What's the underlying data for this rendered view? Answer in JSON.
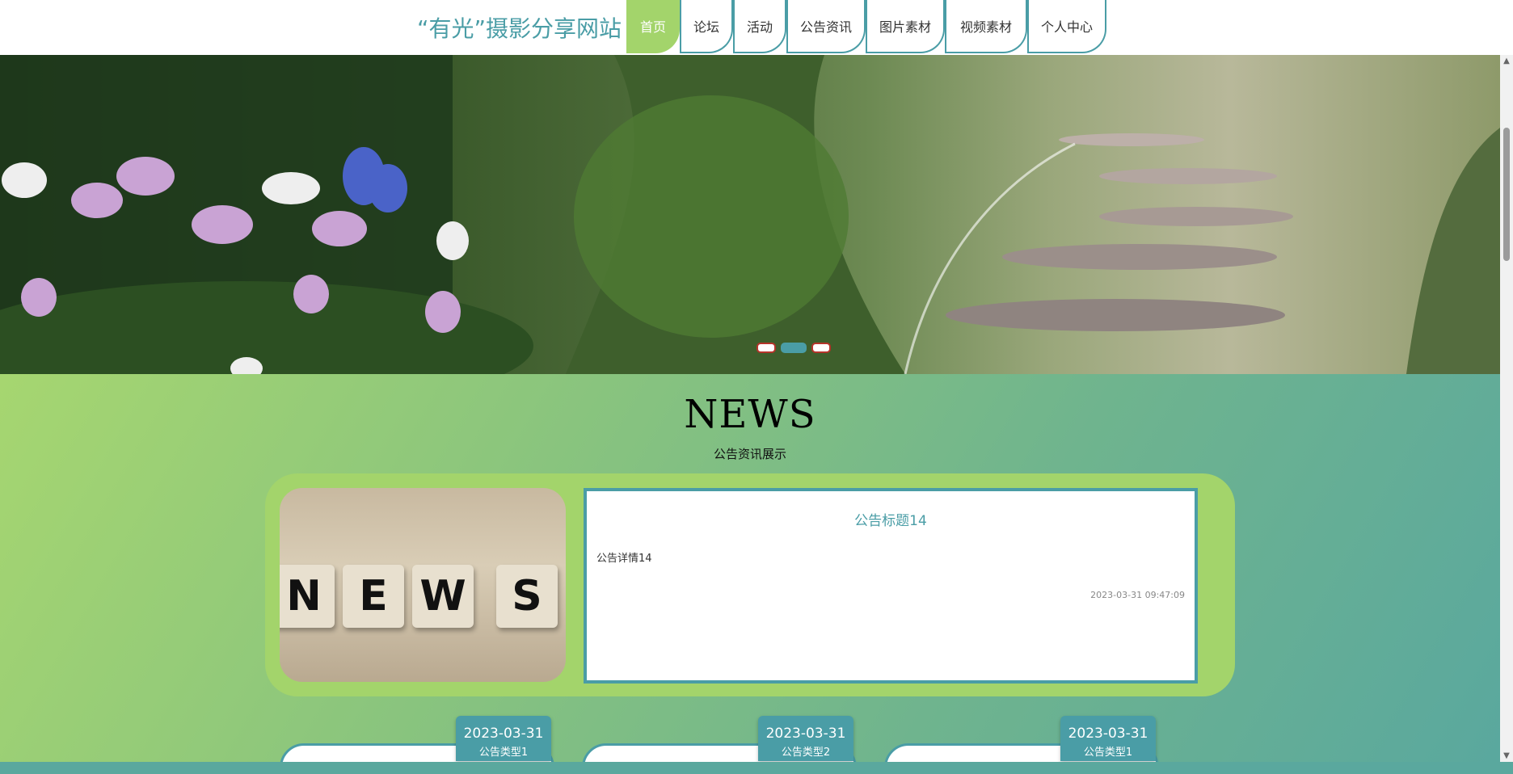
{
  "header": {
    "site_title": "“有光”摄影分享网站",
    "nav": [
      {
        "label": "首页",
        "active": true
      },
      {
        "label": "论坛",
        "active": false
      },
      {
        "label": "活动",
        "active": false
      },
      {
        "label": "公告资讯",
        "active": false
      },
      {
        "label": "图片素材",
        "active": false
      },
      {
        "label": "视频素材",
        "active": false
      },
      {
        "label": "个人中心",
        "active": false
      }
    ]
  },
  "carousel": {
    "slide_count": 3,
    "active_index": 1
  },
  "news": {
    "heading": "NEWS",
    "subheading": "公告资讯展示",
    "featured": {
      "image_letters": [
        "N",
        "E",
        "W",
        "S"
      ],
      "title": "公告标题14",
      "body": "公告详情14",
      "time": "2023-03-31 09:47:09"
    },
    "cards": [
      {
        "date": "2023-03-31",
        "type": "公告类型1"
      },
      {
        "date": "2023-03-31",
        "type": "公告类型2"
      },
      {
        "date": "2023-03-31",
        "type": "公告类型1"
      }
    ]
  },
  "colors": {
    "accent": "#4a9da6",
    "nav_active": "#a3d46b",
    "card_bg": "#a3d46b"
  }
}
